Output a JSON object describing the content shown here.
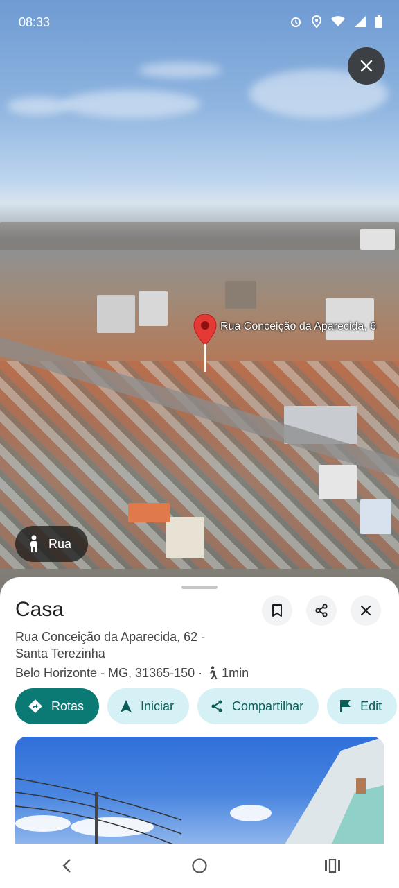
{
  "status_bar": {
    "time": "08:33",
    "icons": [
      "alarm-icon",
      "location-icon",
      "wifi-icon",
      "signal-icon",
      "battery-icon"
    ]
  },
  "map": {
    "pin_label": "Rua Conceição da Aparecida, 6",
    "street_chip_label": "Rua"
  },
  "place": {
    "title": "Casa",
    "address_line1": "Rua Conceição da Aparecida, 62 -",
    "address_line2": "Santa Terezinha",
    "address_line3": "Belo Horizonte - MG, 31365-150 ·",
    "walk_time": "1min"
  },
  "actions": [
    {
      "label": "Rotas",
      "icon": "directions-icon"
    },
    {
      "label": "Iniciar",
      "icon": "navigation-arrow-icon"
    },
    {
      "label": "Compartilhar",
      "icon": "share-icon"
    },
    {
      "label": "Edit",
      "icon": "flag-icon"
    }
  ],
  "colors": {
    "primary": "#0b7a75",
    "secondary_pill": "#d5f1f5",
    "pin": "#e53935"
  }
}
